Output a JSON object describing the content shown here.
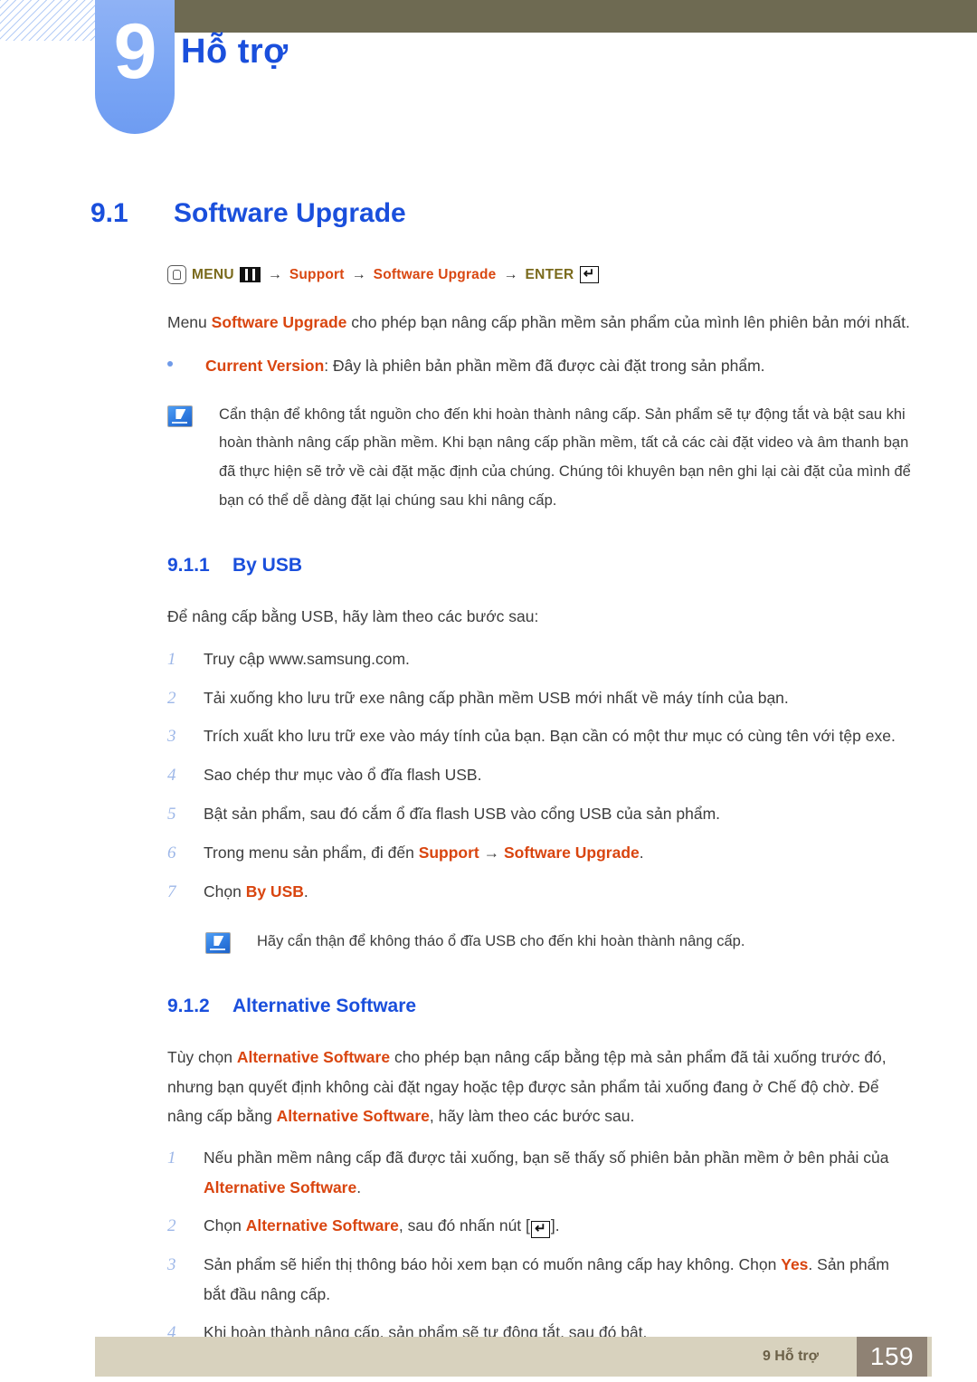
{
  "header": {
    "chapter_number": "9",
    "chapter_title": "Hỗ trợ"
  },
  "section": {
    "number": "9.1",
    "title": "Software Upgrade"
  },
  "menu_path": {
    "press_icon": "hand-press-icon",
    "menu_label": "MENU",
    "menu_icon": "menu-bars-icon",
    "arrow1": "→",
    "support_label": "Support",
    "arrow2": "→",
    "software_upgrade_label": "Software Upgrade",
    "arrow3": "→",
    "enter_label": "ENTER",
    "enter_icon": "enter-key-icon"
  },
  "intro": {
    "part1": "Menu ",
    "bold1": "Software Upgrade",
    "part2": " cho phép bạn nâng cấp phần mềm sản phẩm của mình lên phiên bản mới nhất."
  },
  "bullet": {
    "bold": "Current Version",
    "rest": ": Đây là phiên bản phần mềm đã được cài đặt trong sản phẩm."
  },
  "note1": {
    "icon": "note-pencil-icon",
    "text": "Cẩn thận để không tắt nguồn cho đến khi hoàn thành nâng cấp. Sản phẩm sẽ tự động tắt và bật sau khi hoàn thành nâng cấp phần mềm. Khi bạn nâng cấp phần mềm, tất cả các cài đặt video và âm thanh bạn đã thực hiện sẽ trở về cài đặt mặc định của chúng. Chúng tôi khuyên bạn nên ghi lại cài đặt của mình để bạn có thể dễ dàng đặt lại chúng sau khi nâng cấp."
  },
  "subsection1": {
    "number": "9.1.1",
    "title": "By USB",
    "lead": "Để nâng cấp bằng USB, hãy làm theo các bước sau:",
    "steps": [
      {
        "n": "1",
        "text": "Truy cập www.samsung.com."
      },
      {
        "n": "2",
        "text": "Tải xuống kho lưu trữ exe nâng cấp phần mềm USB mới nhất về máy tính của bạn."
      },
      {
        "n": "3",
        "text": "Trích xuất kho lưu trữ exe vào máy tính của bạn. Bạn cần có một thư mục có cùng tên với tệp exe."
      },
      {
        "n": "4",
        "text": "Sao chép thư mục vào ổ đĩa flash USB."
      },
      {
        "n": "5",
        "text": "Bật sản phẩm, sau đó cắm ổ đĩa flash USB vào cổng USB của sản phẩm."
      }
    ],
    "step6": {
      "n": "6",
      "pre": "Trong menu sản phẩm, đi đến ",
      "bold1": "Support",
      "arrow": " → ",
      "bold2": "Software Upgrade",
      "post": "."
    },
    "step7": {
      "n": "7",
      "pre": "Chọn ",
      "bold1": "By USB",
      "post": "."
    },
    "note": {
      "icon": "note-pencil-icon",
      "text": "Hãy cẩn thận để không tháo ổ đĩa USB cho đến khi hoàn thành nâng cấp."
    }
  },
  "subsection2": {
    "number": "9.1.2",
    "title": "Alternative Software",
    "lead": {
      "part1": "Tùy chọn ",
      "bold1": "Alternative Software",
      "part2": " cho phép bạn nâng cấp bằng tệp mà sản phẩm đã tải xuống trước đó, nhưng bạn quyết định không cài đặt ngay hoặc tệp được sản phẩm tải xuống đang ở Chế độ chờ. Để nâng cấp bằng ",
      "bold2": "Alternative Software",
      "part3": ", hãy làm theo các bước sau."
    },
    "step1": {
      "n": "1",
      "pre": "Nếu phần mềm nâng cấp đã được tải xuống, bạn sẽ thấy số phiên bản phần mềm ở bên phải của ",
      "bold1": "Alternative Software",
      "post": "."
    },
    "step2": {
      "n": "2",
      "pre": "Chọn ",
      "bold1": "Alternative Software",
      "mid": ", sau đó nhấn nút [",
      "icon": "enter-key-icon",
      "post": "]."
    },
    "step3": {
      "n": "3",
      "pre": "Sản phẩm sẽ hiển thị thông báo hỏi xem bạn có muốn nâng cấp hay không. Chọn ",
      "bold1": "Yes",
      "post": ". Sản phẩm bắt đầu nâng cấp."
    },
    "step4": {
      "n": "4",
      "text": "Khi hoàn thành nâng cấp, sản phẩm sẽ tự động tắt, sau đó bật."
    }
  },
  "footer": {
    "label": "9 Hỗ trợ",
    "page_number": "159"
  },
  "colors": {
    "heading_blue": "#1a4fdc",
    "accent_red": "#d9450f",
    "menu_olive": "#7a6a1c",
    "header_bar": "#6e6a52",
    "tab_blue": "#7ba6f4",
    "footer_bar": "#d8d2be",
    "footer_page_box": "#8f8274",
    "step_number": "#9db7e8"
  }
}
